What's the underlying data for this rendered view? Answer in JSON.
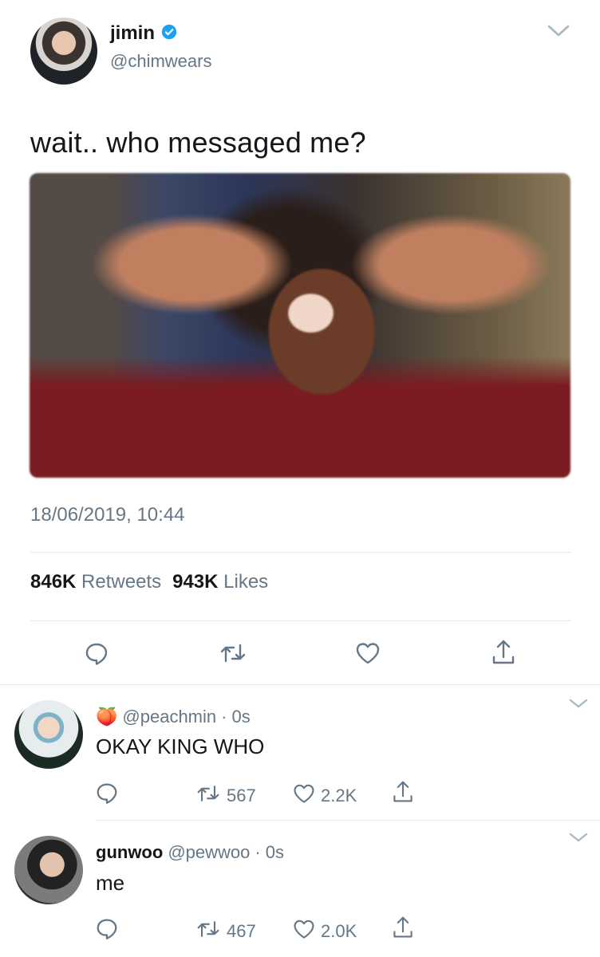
{
  "main_tweet": {
    "display_name": "jimin",
    "verified": true,
    "handle": "@chimwears",
    "text": "wait.. who messaged me?",
    "timestamp": "18/06/2019, 10:44",
    "retweets_count": "846K",
    "retweets_label": "Retweets",
    "likes_count": "943K",
    "likes_label": "Likes"
  },
  "replies": [
    {
      "emoji": "🍑",
      "display_name": "",
      "handle": "@peachmin",
      "dot": "·",
      "time": "0s",
      "text": "OKAY KING WHO",
      "retweets": "567",
      "likes": "2.2K"
    },
    {
      "display_name": "gunwoo",
      "handle": "@pewwoo",
      "dot": "·",
      "time": "0s",
      "text": "me",
      "retweets": "467",
      "likes": "2.0K"
    }
  ],
  "colors": {
    "text": "#14171a",
    "secondary": "#657786",
    "verified": "#1da1f2",
    "divider": "#e1e8ed"
  },
  "icons": [
    "chevron-down-icon",
    "verified-badge-icon",
    "reply-icon",
    "retweet-icon",
    "like-icon",
    "share-icon"
  ]
}
